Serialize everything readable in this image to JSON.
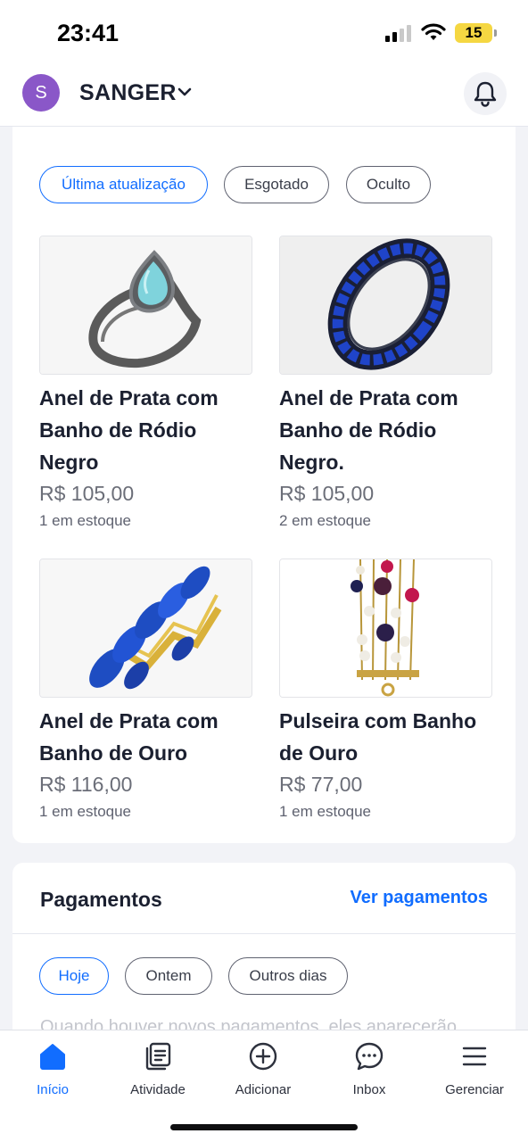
{
  "status_bar": {
    "time": "23:41",
    "battery": "15"
  },
  "header": {
    "avatar_letter": "S",
    "site_name": "SANGER",
    "avatar_color": "#8a57c8"
  },
  "filters": [
    {
      "label": "Última atualização",
      "active": true
    },
    {
      "label": "Esgotado",
      "active": false
    },
    {
      "label": "Oculto",
      "active": false
    }
  ],
  "products": [
    {
      "name": "Anel de Prata com Banho de Ródio Negro",
      "price": "R$ 105,00",
      "stock": "1 em estoque",
      "image_icon": "pear-ring-image"
    },
    {
      "name": "Anel de Prata com Banho de Ródio Negro.",
      "price": "R$ 105,00",
      "stock": "2 em estoque",
      "image_icon": "sapphire-band-image"
    },
    {
      "name": "Anel de Prata com Banho de Ouro",
      "price": "R$ 116,00",
      "stock": "1 em estoque",
      "image_icon": "gold-ring-image"
    },
    {
      "name": "Pulseira com Banho de Ouro",
      "price": "R$ 77,00",
      "stock": "1 em estoque",
      "image_icon": "bracelet-image"
    }
  ],
  "payments": {
    "title": "Pagamentos",
    "link": "Ver pagamentos",
    "chips": [
      {
        "label": "Hoje",
        "active": true
      },
      {
        "label": "Ontem",
        "active": false
      },
      {
        "label": "Outros dias",
        "active": false
      }
    ],
    "hint": "Quando houver novos pagamentos, eles aparecerão"
  },
  "bottom_nav": [
    {
      "label": "Início",
      "icon": "home-icon",
      "active": true
    },
    {
      "label": "Atividade",
      "icon": "activity-icon",
      "active": false
    },
    {
      "label": "Adicionar",
      "icon": "add-circle-icon",
      "active": false
    },
    {
      "label": "Inbox",
      "icon": "chat-bubble-icon",
      "active": false
    },
    {
      "label": "Gerenciar",
      "icon": "menu-icon",
      "active": false
    }
  ],
  "colors": {
    "accent": "#116dff",
    "text": "#1b2030",
    "muted": "#6b6e78",
    "background": "#f2f3f7"
  }
}
